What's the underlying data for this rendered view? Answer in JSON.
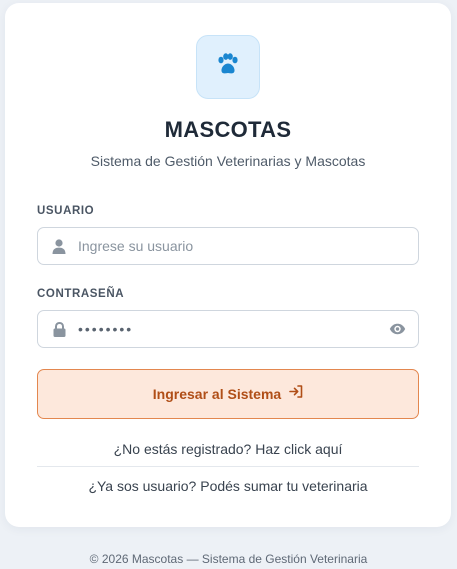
{
  "app": {
    "title": "MASCOTAS",
    "subtitle": "Sistema de Gestión Veterinarias y Mascotas",
    "logo_icon": "paw-icon"
  },
  "form": {
    "username": {
      "label": "USUARIO",
      "placeholder": "Ingrese su usuario",
      "value": "",
      "icon": "user-icon"
    },
    "password": {
      "label": "CONTRASEÑA",
      "value": "••••••••",
      "icon": "lock-icon",
      "toggle_icon": "eye-icon"
    },
    "submit": {
      "label": "Ingresar al Sistema",
      "icon": "login-arrow-icon"
    }
  },
  "links": {
    "register": "¿No estás registrado? Haz click aquí",
    "add_vet": "¿Ya sos usuario? Podés sumar tu veterinaria"
  },
  "footer": {
    "text": "© 2026 Mascotas — Sistema de Gestión Veterinaria"
  },
  "colors": {
    "accent": "#e3874f",
    "accent_bg": "#fde8dc",
    "accent_text": "#b04e17",
    "logo_bg": "#e0f0fd",
    "logo_icon": "#1a86d0"
  }
}
